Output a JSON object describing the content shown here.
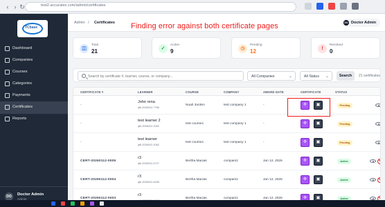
{
  "browser": {
    "url": "test2.accuratex.com/admin/certificates",
    "icons": [
      "back-icon",
      "forward-icon",
      "reload-icon",
      "extension-icon",
      "profile-icon",
      "menu-icon"
    ]
  },
  "sidebar": {
    "logo_text": "TCbase",
    "items": [
      {
        "label": "Dashboard",
        "icon": "dashboard-icon"
      },
      {
        "label": "Companies",
        "icon": "building-icon"
      },
      {
        "label": "Courses",
        "icon": "book-icon"
      },
      {
        "label": "Categories",
        "icon": "folder-icon"
      },
      {
        "label": "Payments",
        "icon": "card-icon"
      },
      {
        "label": "Certificates",
        "icon": "certificate-icon"
      },
      {
        "label": "Reports",
        "icon": "chart-icon"
      }
    ],
    "user": {
      "initials": "DO",
      "name": "Doctor Admin",
      "role": "Admin"
    }
  },
  "header": {
    "breadcrumbs": [
      "Admin",
      "/",
      "Certificates"
    ],
    "admin_initials": "DO",
    "admin_label": "Doctor Admin"
  },
  "annotation": {
    "text": "Finding error against both certificate pages",
    "color": "#ef1b1b"
  },
  "stats": [
    {
      "label": "Total",
      "value": "21",
      "icon": "certificate-icon",
      "color": "#2563eb",
      "bg": "#dbeafe"
    },
    {
      "label": "Active",
      "value": "9",
      "icon": "check-icon",
      "color": "#16a34a",
      "bg": "#dcfce7"
    },
    {
      "label": "Pending",
      "value": "12",
      "icon": "clock-icon",
      "color": "#f97316",
      "bg": "#ffedd5"
    },
    {
      "label": "Revoked",
      "value": "0",
      "icon": "warning-icon",
      "color": "#dc2626",
      "bg": "#fee2e2"
    }
  ],
  "filters": {
    "search_placeholder": "Search by certificate #, learner, course, or company...",
    "company": "All Companies",
    "status": "All Status",
    "search_button": "Search",
    "count": "21 certificates"
  },
  "table": {
    "headers": [
      "CERTIFICATE #",
      "LEARNER",
      "COURSE",
      "COMPANY",
      "AWARD DATE",
      "CERTIFICATE",
      "STATUS"
    ],
    "rows": [
      {
        "cert": "-",
        "learner": "John rena",
        "learner_sub": "qfk-2026012-7766",
        "course": "Noah 3orden",
        "company": "test company 1",
        "award": "-",
        "status": "Pending"
      },
      {
        "cert": "-",
        "learner": "test learner 2",
        "learner_sub": "qfk-2026012-1062",
        "course": "test course1",
        "company": "test company 1",
        "award": "-",
        "status": "Pending"
      },
      {
        "cert": "-",
        "learner": "test learner",
        "learner_sub": "qfk-2026012-1062",
        "course": "test course1",
        "company": "test company 1",
        "award": "-",
        "status": "Pending"
      },
      {
        "cert": "CERT-20260112-0005",
        "learner": "r3",
        "learner_sub": "qfk-2026012-4727",
        "course": "Bertha Macias",
        "company": "compani1",
        "award": "Jan 12, 2026",
        "status": "Active"
      },
      {
        "cert": "CERT-20260112-0004",
        "learner": "r3",
        "learner_sub": "qfk-2026012-4495",
        "course": "Bertha Macias",
        "company": "compani1",
        "award": "Jan 12, 2026",
        "status": "Active"
      },
      {
        "cert": "CERT-20260112-0003",
        "learner": "r3",
        "learner_sub": "qfk-2026012-4495",
        "course": "Bertha Macias",
        "company": "compani1",
        "award": "Jan 12, 2026",
        "status": "Active"
      }
    ]
  },
  "colors": {
    "sidebar": "#1f2937",
    "violet": "#a855f7",
    "pending": "#b45309",
    "active": "#15803d"
  }
}
